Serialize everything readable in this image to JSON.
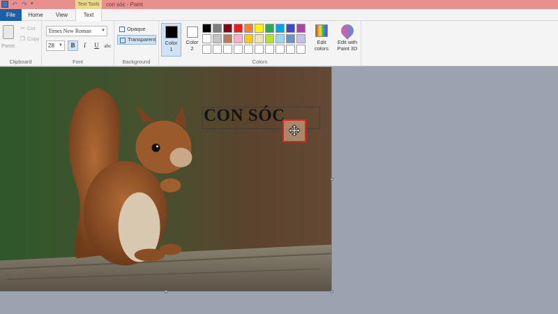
{
  "window": {
    "title": "con sóc - Paint",
    "context_tab": "Text Tools"
  },
  "tabs": [
    {
      "label": "File",
      "active": false
    },
    {
      "label": "Home",
      "active": false
    },
    {
      "label": "View",
      "active": false
    },
    {
      "label": "Text",
      "active": true
    }
  ],
  "clipboard": {
    "paste": "Paste",
    "cut": "Cut",
    "copy": "Copy",
    "group_label": "Clipboard"
  },
  "font": {
    "family": "Times New Roman",
    "size": "28",
    "bold": "B",
    "italic": "I",
    "underline": "U",
    "strikethrough": "abc",
    "bold_active": true,
    "group_label": "Font"
  },
  "background": {
    "opaque": "Opaque",
    "transparent": "Transparent",
    "selected": "Transparent",
    "group_label": "Background"
  },
  "colors": {
    "color1_label": "Color",
    "color1_num": "1",
    "color2_label": "Color",
    "color2_num": "2",
    "color1_value": "#000000",
    "color2_value": "#ffffff",
    "edit_colors": "Edit colors",
    "edit_with_paint3d": "Edit with Paint 3D",
    "group_label": "Colors",
    "palette": [
      "#000000",
      "#7f7f7f",
      "#880015",
      "#ed1c24",
      "#ff7f27",
      "#fff200",
      "#22b14c",
      "#00a2e8",
      "#3f48cc",
      "#a349a4",
      "#ffffff",
      "#c3c3c3",
      "#b97a57",
      "#ffaec9",
      "#ffc90e",
      "#efe4b0",
      "#b5e61d",
      "#99d9ea",
      "#7092be",
      "#c8bfe7",
      "#ffffff",
      "#ffffff",
      "#ffffff",
      "#ffffff",
      "#ffffff",
      "#ffffff",
      "#ffffff",
      "#ffffff",
      "#ffffff",
      "#ffffff"
    ]
  },
  "canvas": {
    "text": "CON SÓC"
  }
}
